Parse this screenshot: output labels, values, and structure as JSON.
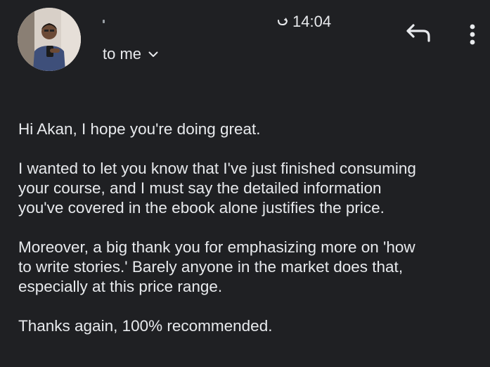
{
  "header": {
    "time": "14:04",
    "recipient": "to me"
  },
  "icons": {
    "snooze": "snooze-icon",
    "reply": "reply-icon",
    "more": "more-vert-icon",
    "chevron": "chevron-down-icon",
    "avatar": "sender-avatar"
  },
  "colors": {
    "background": "#1f2023",
    "text": "#e8eaed",
    "muted": "#9aa0a6"
  },
  "message": {
    "greeting": "Hi Akan, I hope you're doing great.",
    "paragraph_1": "I wanted to let you know that I've just finished consuming\nyour course, and I must say the detailed information\nyou've covered in the ebook alone justifies the price.",
    "paragraph_2": "Moreover, a big thank you for emphasizing more on 'how\nto write stories.' Barely anyone in the market does that,\nespecially at this price range.",
    "closing": "Thanks again, 100% recommended."
  }
}
